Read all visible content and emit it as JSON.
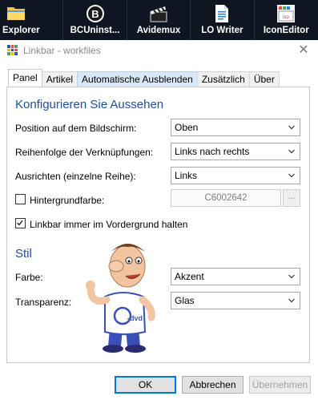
{
  "taskbar": {
    "items": [
      {
        "label": "Explorer",
        "icon": "folder-icon"
      },
      {
        "label": "BCUninst...",
        "icon": "bcuninstaller-icon"
      },
      {
        "label": "Avidemux",
        "icon": "clapperboard-icon"
      },
      {
        "label": "LO Writer",
        "icon": "document-icon"
      },
      {
        "label": "IconEditor",
        "icon": "icon-editor-icon"
      }
    ]
  },
  "window": {
    "title": "Linkbar - workfiles",
    "close_glyph": "✕"
  },
  "tabs": [
    {
      "label": "Panel",
      "state": "active"
    },
    {
      "label": "Artikel",
      "state": "normal"
    },
    {
      "label": "Automatische Ausblenden",
      "state": "hover"
    },
    {
      "label": "Zusätzlich",
      "state": "normal"
    },
    {
      "label": "Über",
      "state": "normal"
    }
  ],
  "appearance": {
    "title": "Konfigurieren Sie Aussehen",
    "position_label": "Position auf dem Bildschirm:",
    "position_value": "Oben",
    "order_label": "Reihenfolge der Verknüpfungen:",
    "order_value": "Links nach rechts",
    "align_label": "Ausrichten (einzelne Reihe):",
    "align_value": "Links",
    "bgcolor_label": "Hintergrundfarbe:",
    "bgcolor_checked": false,
    "bgcolor_value": "C6002642",
    "bgcolor_button": "...",
    "foreground_label": "Linkbar immer im Vordergrund halten",
    "foreground_checked": true
  },
  "style": {
    "title": "Stil",
    "color_label": "Farbe:",
    "color_value": "Akzent",
    "transparency_label": "Transparenz:",
    "transparency_value": "Glas",
    "mascot_shirt_text": "-dvd"
  },
  "buttons": {
    "ok": "OK",
    "cancel": "Abbrechen",
    "apply": "Übernehmen"
  },
  "colors": {
    "taskbar_bg": "#0f1621",
    "section_title": "#1f4e9c",
    "tab_hover": "#d9e8f7",
    "primary_border": "#0078d7"
  }
}
